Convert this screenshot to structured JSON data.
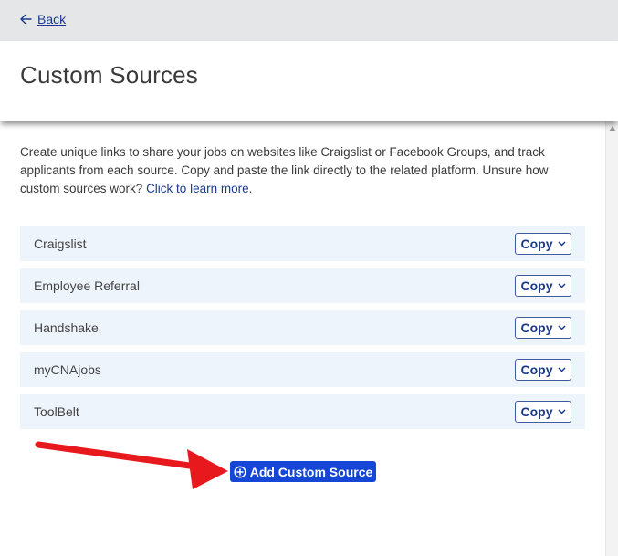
{
  "nav": {
    "back_label": "Back"
  },
  "header": {
    "title": "Custom Sources"
  },
  "description": {
    "text": "Create unique links to share your jobs on websites like Craigslist or Facebook Groups, and track applicants from each source. Copy and paste the link directly to the related platform. Unsure how custom sources work?",
    "link_label": "Click to learn more",
    "trailing": "."
  },
  "sources": [
    {
      "name": "Craigslist",
      "copy_label": "Copy"
    },
    {
      "name": "Employee Referral",
      "copy_label": "Copy"
    },
    {
      "name": "Handshake",
      "copy_label": "Copy"
    },
    {
      "name": "myCNAjobs",
      "copy_label": "Copy"
    },
    {
      "name": "ToolBelt",
      "copy_label": "Copy"
    }
  ],
  "actions": {
    "add_label": "Add Custom Source"
  },
  "icons": {
    "back": "arrow-left-icon",
    "copy_dropdown": "chevron-down-icon",
    "add": "plus-circle-icon",
    "annotation": "red-arrow-icon"
  },
  "colors": {
    "link": "#1b3a8c",
    "primary_button": "#1546d6",
    "row_background": "#eef4fc",
    "annotation": "#e8191c"
  }
}
